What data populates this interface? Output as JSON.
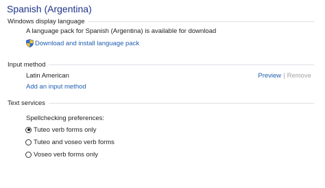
{
  "page": {
    "title": "Spanish (Argentina)"
  },
  "display_language": {
    "header": "Windows display language",
    "message": "A language pack for Spanish (Argentina) is available for download",
    "download_link": "Download and install language pack"
  },
  "input_method": {
    "header": "Input method",
    "item": "Latin American",
    "preview": "Preview",
    "separator": "|",
    "remove": "Remove",
    "add_link": "Add an input method"
  },
  "text_services": {
    "header": "Text services",
    "spellcheck_label": "Spellchecking preferences:",
    "options": [
      {
        "label": "Tuteo verb forms only",
        "selected": true
      },
      {
        "label": "Tuteo and voseo verb forms",
        "selected": false
      },
      {
        "label": "Voseo verb forms only",
        "selected": false
      }
    ]
  },
  "icons": {
    "shield": "shield-icon"
  },
  "colors": {
    "title": "#1e3287",
    "link": "#1f5eb0",
    "divider": "#dcdfe5",
    "disabled": "#a0a0a0"
  }
}
